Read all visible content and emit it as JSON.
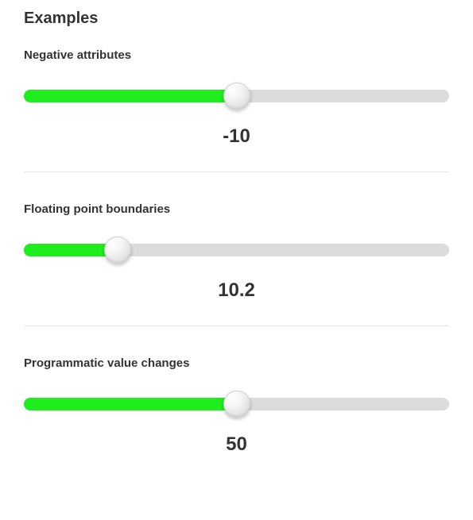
{
  "section_title": "Examples",
  "examples": [
    {
      "label": "Negative attributes",
      "value_display": "-10",
      "fill_percent": 50,
      "handle_percent": 50
    },
    {
      "label": "Floating point boundaries",
      "value_display": "10.2",
      "fill_percent": 22,
      "handle_percent": 22
    },
    {
      "label": "Programmatic value changes",
      "value_display": "50",
      "fill_percent": 50,
      "handle_percent": 50
    }
  ],
  "colors": {
    "fill": "#1eee1e",
    "track": "#dcdcdc"
  }
}
